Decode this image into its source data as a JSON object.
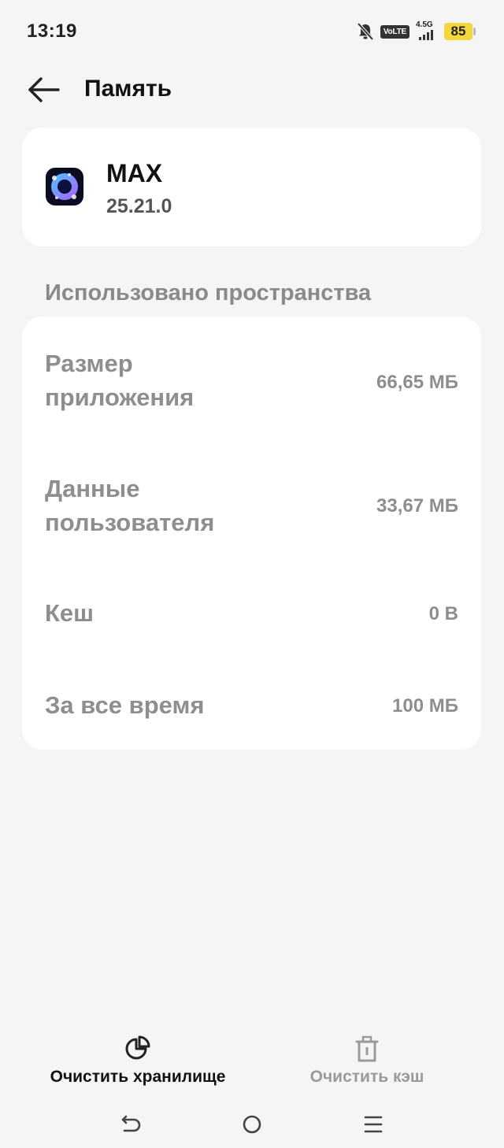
{
  "status_bar": {
    "time": "13:19",
    "volte": "VoLTE",
    "network": "4.5G",
    "battery": "85"
  },
  "header": {
    "title": "Память"
  },
  "app": {
    "name": "MAX",
    "version": "25.21.0"
  },
  "section_title": "Использовано пространства",
  "storage": {
    "rows": [
      {
        "label": "Размер приложения",
        "value": "66,65 МБ"
      },
      {
        "label": "Данные пользователя",
        "value": "33,67 МБ"
      },
      {
        "label": "Кеш",
        "value": "0 B"
      },
      {
        "label": "За все время",
        "value": "100 МБ"
      }
    ]
  },
  "actions": {
    "clear_storage": "Очистить хранилище",
    "clear_cache": "Очистить кэш"
  },
  "colors": {
    "background": "#f5f5f5",
    "card": "#ffffff",
    "muted_text": "#8e8e8e",
    "battery": "#f2d63b",
    "disabled": "#9a9a9a"
  }
}
